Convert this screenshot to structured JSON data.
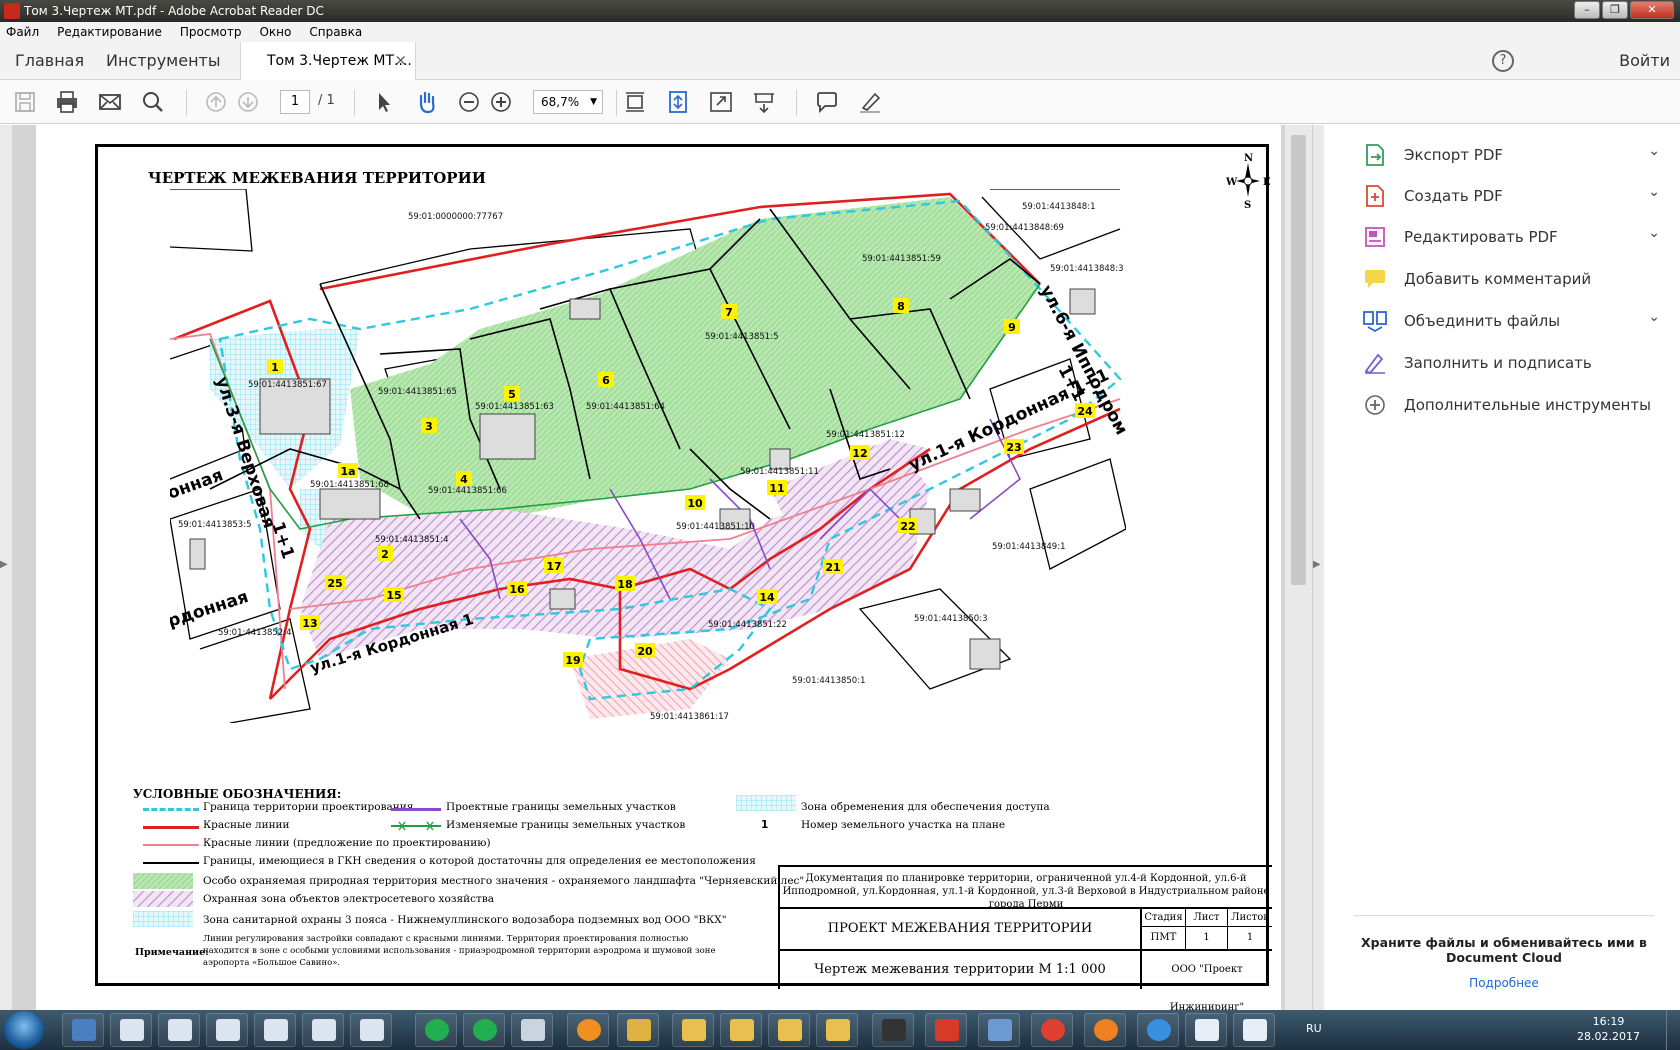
{
  "window": {
    "title": "Том 3.Чертеж МТ.pdf - Adobe Acrobat Reader DC",
    "controls": [
      "–",
      "❐",
      "✕"
    ]
  },
  "menu": [
    "Файл",
    "Редактирование",
    "Просмотр",
    "Окно",
    "Справка"
  ],
  "tabs": {
    "home": "Главная",
    "tools": "Инструменты",
    "document": "Том 3.Чертеж МТ....",
    "close": "×",
    "help": "?",
    "signin": "Войти"
  },
  "toolbar": {
    "page_current": "1",
    "page_total": "/ 1",
    "zoom": "68,7%",
    "icons": [
      "save-icon",
      "print-icon",
      "email-icon",
      "search-icon",
      "page-up-icon",
      "page-down-icon",
      "select-arrow-icon",
      "hand-icon",
      "zoom-out-icon",
      "zoom-in-icon",
      "scroll-mode-icon",
      "fit-page-icon",
      "full-screen-icon",
      "read-mode-icon",
      "comment-icon",
      "highlight-pen-icon"
    ]
  },
  "drawing": {
    "title": "ЧЕРТЕЖ МЕЖЕВАНИЯ ТЕРРИТОРИИ",
    "compass": {
      "n": "N",
      "s": "S",
      "w": "W",
      "e": "E"
    },
    "map_labels": {
      "cad1": "59:01:0000000:77767",
      "cad2": "59:01:4413848:1",
      "cad3": "59:01:4413848:69",
      "cad4": "59:01:4413851:59",
      "cad5": "59:01:4413851:5",
      "cad6": "59:01:4413851:67",
      "cad7": "59:01:4413851:65",
      "cad8": "59:01:4413851:63",
      "cad9": "59:01:4413851:64",
      "cad10": "59:01:4413851:68",
      "cad11": "59:01:4413851:66",
      "cad12": "59:01:4413851:4",
      "cad13": "59:01:4413851:12",
      "cad14": "59:01:4413851:11",
      "cad15": "59:01:4413851:10",
      "cad16": "59:01:4413851:22",
      "cad17": "59:01:4413849:1",
      "cad18": "59:01:4413850:3",
      "cad19": "59:01:4413850:1",
      "cad20": "59:01:4413861:17",
      "cad21": "59:01:4413852:4",
      "cad22": "59:01:4413853:5",
      "cad23": "59:01:4413848:3",
      "street1": "ул.3-я Верховая",
      "street1b": "1+1",
      "street2": "ул.1-я Кордонная 1+1",
      "street3": "ул.1-я Кордонная 1",
      "street4": "ул.6-я Ипподром",
      "street4b": "1+1",
      "street5": "онная",
      "street6": "рдонная",
      "n1": "1",
      "n1a": "1а",
      "n2": "2",
      "n3": "3",
      "n4": "4",
      "n5": "5",
      "n6": "6",
      "n7": "7",
      "n8": "8",
      "n9": "9",
      "n10": "10",
      "n11": "11",
      "n12": "12",
      "n13": "13",
      "n14": "14",
      "n15": "15",
      "n16": "16",
      "n17": "17",
      "n18": "18",
      "n19": "19",
      "n20": "20",
      "n21": "21",
      "n22": "22",
      "n23": "23",
      "n24": "24",
      "n25": "25"
    },
    "legend": {
      "heading": "УСЛОВНЫЕ ОБОЗНАЧЕНИЯ:",
      "items": [
        "Граница территории проектирования",
        "Красные линии",
        "Красные линии (предложение по проектированию)",
        "Границы, имеющиеся в ГКН сведения о которой достаточны для определения  ее местоположения",
        "Особо охраняемая природная территория местного значения - охраняемого ландшафта \"Черняевский лес\"",
        "Охранная зона объектов электросетевого хозяйства",
        "Зона санитарной охраны 3 пояса - Нижнемуллинского водозабора подземных вод ООО \"ВКХ\"",
        "Проектные границы земельных участков",
        "Изменяемые границы земельных участков",
        "Зона обременения для обеспечения доступа",
        "Номер земельного участка на плане"
      ],
      "number_sample": "1",
      "note_label": "Примечание:",
      "note_text": "Линии регулирования застройки совпадают с красными линиями. Территория проектирования полностью находится в зоне с особыми условиями использования - приаэродромной    территории аэродрома и шумовой зоне аэропорта «Большое Савино»."
    },
    "title_block": {
      "description": "Документация по планировке территории, ограниченной ул.4-й Кордонной, ул.6-й Ипподромной, ул.Кордонная, ул.1-й Кордонной, ул.3-й Верховой в Индустриальном районе города Перми",
      "project": "ПРОЕКТ МЕЖЕВАНИЯ ТЕРРИТОРИИ",
      "drawing": "Чертеж межевания территории   М 1:1 000",
      "stage_h": "Стадия",
      "sheet_h": "Лист",
      "sheets_h": "Листов",
      "stage": "ПМТ",
      "sheet": "1",
      "sheets": "1",
      "org": "ООО \"Проект Инжиниринг\""
    }
  },
  "right_panel": {
    "items": [
      {
        "label": "Экспорт PDF",
        "icon": "export-pdf-icon",
        "color": "#3a9a5a",
        "chevron": true
      },
      {
        "label": "Создать PDF",
        "icon": "create-pdf-icon",
        "color": "#d84a3a",
        "chevron": true
      },
      {
        "label": "Редактировать PDF",
        "icon": "edit-pdf-icon",
        "color": "#c850c0",
        "chevron": true
      },
      {
        "label": "Добавить комментарий",
        "icon": "comment-add-icon",
        "color": "#e8c020",
        "chevron": false
      },
      {
        "label": "Объединить файлы",
        "icon": "combine-files-icon",
        "color": "#2a6ad0",
        "chevron": true
      },
      {
        "label": "Заполнить и подписать",
        "icon": "fill-sign-icon",
        "color": "#7a5ad0",
        "chevron": false
      },
      {
        "label": "Дополнительные инструменты",
        "icon": "more-tools-icon",
        "color": "#666666",
        "chevron": false
      }
    ],
    "cloud_text": "Храните файлы и обменивайтесь ими в Document Cloud",
    "cloud_link": "Подробнее"
  },
  "taskbar": {
    "lang": "RU",
    "time": "16:19",
    "date": "28.02.2017",
    "apps": [
      "start-orb-icon",
      "app-icon",
      "window-icon",
      "window-icon",
      "window-icon",
      "window-icon",
      "window-icon",
      "window-icon",
      "mail-agent-icon",
      "mail-agent-icon",
      "mail-icon",
      "media-icon",
      "player-icon",
      "folder-icon",
      "folder-icon",
      "folder-icon",
      "folder-icon",
      "phone-icon",
      "acrobat-icon",
      "speaker-icon",
      "chrome-icon",
      "firefox-icon",
      "ie-icon",
      "word-icon",
      "word-icon"
    ]
  }
}
